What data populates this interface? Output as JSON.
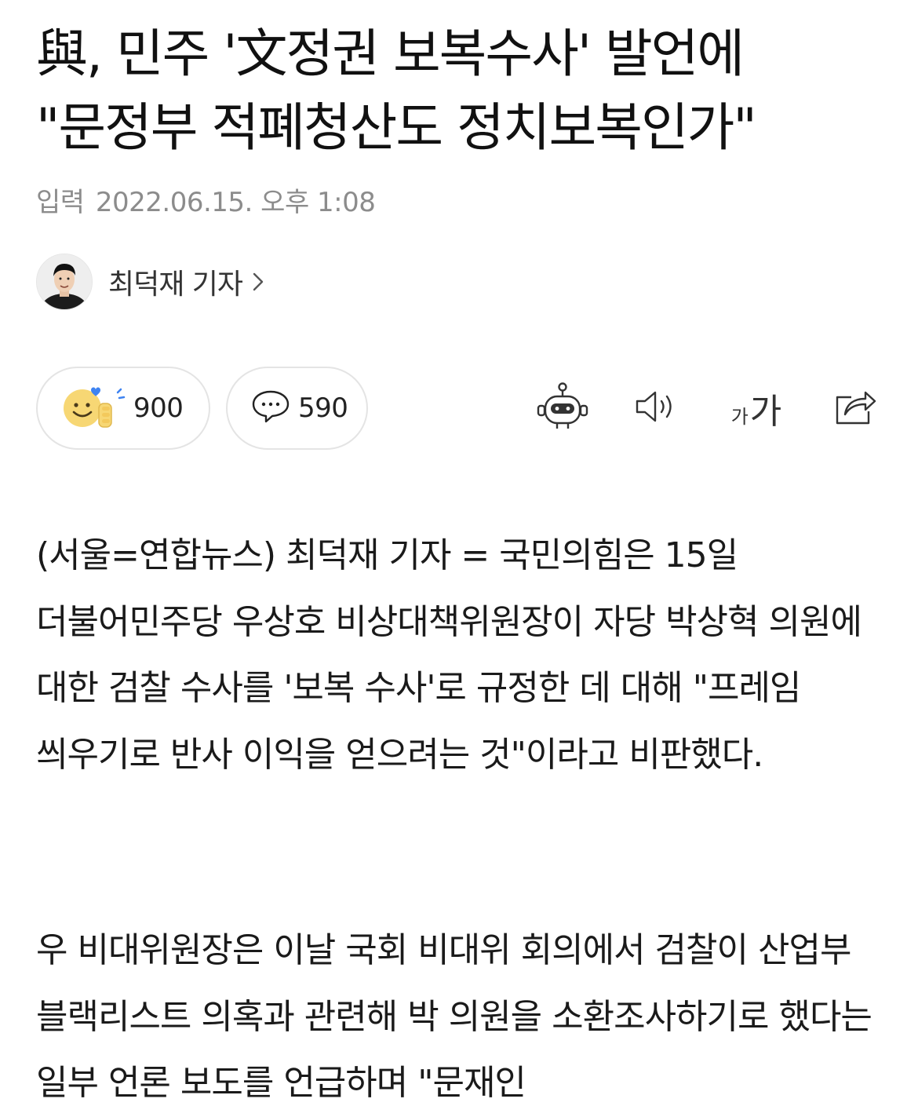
{
  "article": {
    "headline_line1": "與, 민주 '文정권 보복수사' 발언에",
    "headline_line2": "\"문정부 적폐청산도 정치보복인가\"",
    "date_label": "입력",
    "date_value": "2022.06.15. 오후 1:08",
    "author_name": "최덕재 기자"
  },
  "actions": {
    "reaction_count": "900",
    "comment_count": "590",
    "font_small_label": "가",
    "font_big_label": "가"
  },
  "icons": {
    "reaction": "smile-thumbs-up-icon",
    "comment": "speech-bubble-icon",
    "summary_bot": "robot-icon",
    "tts": "speaker-icon",
    "font_size": "font-size-icon",
    "share": "share-icon",
    "author_chevron": "chevron-right-icon"
  },
  "colors": {
    "text_primary": "#111111",
    "text_meta": "#8c8c8c",
    "border": "#e4e4e4",
    "emoji_yellow": "#f7d774",
    "emoji_heart": "#3e83f1"
  },
  "body": {
    "p1": "(서울=연합뉴스) 최덕재 기자 = 국민의힘은 15일 더불어민주당 우상호 비상대책위원장이 자당 박상혁 의원에 대한 검찰 수사를 '보복 수사'로 규정한 데 대해 \"프레임 씌우기로 반사 이익을 얻으려는 것\"이라고 비판했다.",
    "p2": "우 비대위원장은 이날 국회 비대위 회의에서 검찰이 산업부 블랙리스트 의혹과 관련해 박 의원을 소환조사하기로 했다는 일부 언론 보도를 언급하며 \"문재인"
  }
}
